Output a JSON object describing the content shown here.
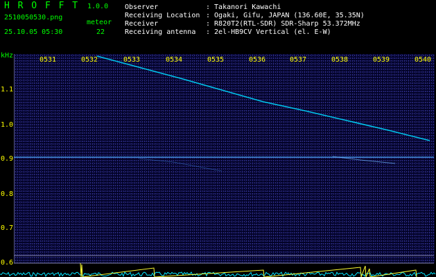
{
  "header": {
    "app_title": "H R O F F T",
    "version": "1.0.0",
    "filename": "2510050530.png",
    "datetime": "25.10.05 05:30",
    "meteor_label": "meteor",
    "meteor_count": "22"
  },
  "info": [
    {
      "label": "Observer",
      "value": ": Takanori Kawachi"
    },
    {
      "label": "Receiving Location",
      "value": ": Ogaki, Gifu, JAPAN (136.60E, 35.35N)"
    },
    {
      "label": "Receiver",
      "value": ": R820T2(RTL-SDR) SDR-Sharp 53.372MHz"
    },
    {
      "label": "Receiving antenna",
      "value": ": 2el-HB9CV Vertical (el. E-W)"
    }
  ],
  "axis": {
    "y_unit": "kHz",
    "x_ticks": [
      "0531",
      "0532",
      "0533",
      "0534",
      "0535",
      "0536",
      "0537",
      "0538",
      "0539",
      "0540"
    ],
    "y_ticks": [
      "1.1",
      "1.0",
      "0.9",
      "0.8",
      "0.7",
      "0.6"
    ]
  },
  "colors": {
    "header_text": "#00ff00",
    "tick_text": "#ffff00",
    "info_text": "#ffffff",
    "background": "#000000",
    "meteor_trace": "#00e0ff",
    "carrier_line": "#4fa8ff"
  }
}
